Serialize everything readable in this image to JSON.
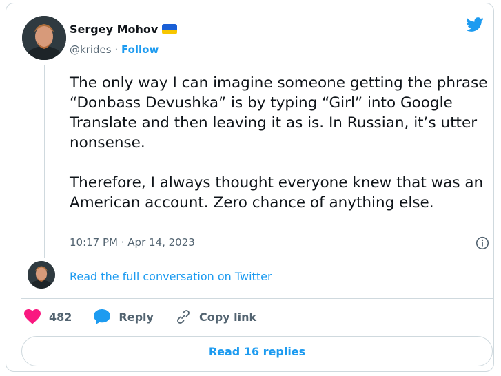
{
  "author": {
    "name": "Sergey Mohov",
    "handle": "@krides",
    "separator": "·",
    "follow_label": "Follow"
  },
  "tweet": {
    "text": "The only way I can imagine someone getting the phrase “Donbass Devushka” is by typing “Girl” into Google Translate and then leaving it as is. In Russian, it’s utter nonsense.\n\nTherefore, I always thought everyone knew that was an American account. Zero chance of anything else.",
    "timestamp": "10:17 PM · Apr 14, 2023"
  },
  "conversation": {
    "link_label": "Read the full conversation on Twitter"
  },
  "actions": {
    "like_count": "482",
    "reply_label": "Reply",
    "copy_label": "Copy link"
  },
  "replies_button": {
    "label": "Read 16 replies"
  },
  "colors": {
    "accent": "#1d9bf0",
    "like": "#f91880",
    "text": "#0f1419",
    "muted": "#536471",
    "border": "#cfd9de"
  },
  "icons": [
    "twitter-bird-icon",
    "ukraine-flag-icon",
    "info-icon",
    "heart-icon",
    "reply-bubble-icon",
    "link-icon"
  ]
}
